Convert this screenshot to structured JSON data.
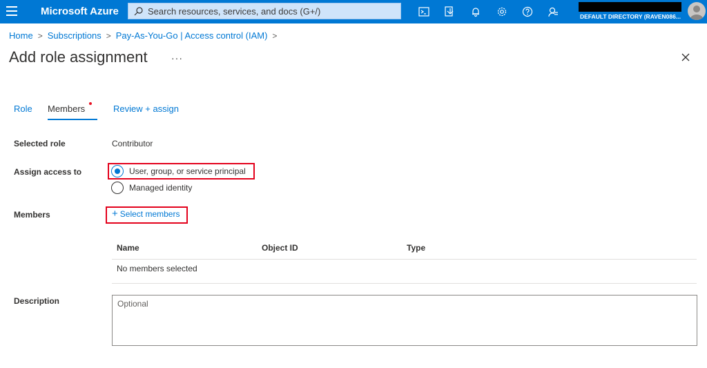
{
  "topbar": {
    "brand": "Microsoft Azure",
    "search_placeholder": "Search resources, services, and docs (G+/)",
    "icons": [
      "cloud-shell-icon",
      "directory-filter-icon",
      "notifications-icon",
      "settings-icon",
      "help-icon",
      "feedback-icon"
    ],
    "tenant": "DEFAULT DIRECTORY (RAVEN086..."
  },
  "breadcrumb": {
    "items": [
      "Home",
      "Subscriptions",
      "Pay-As-You-Go | Access control (IAM)"
    ]
  },
  "page": {
    "title": "Add role assignment",
    "more": "···"
  },
  "tabs": [
    {
      "label": "Role"
    },
    {
      "label": "Members"
    },
    {
      "label": "Review + assign"
    }
  ],
  "form": {
    "selected_role_label": "Selected role",
    "selected_role_value": "Contributor",
    "assign_access_label": "Assign access to",
    "options": [
      {
        "label": "User, group, or service principal",
        "checked": true
      },
      {
        "label": "Managed identity",
        "checked": false
      }
    ],
    "members_label": "Members",
    "select_members": "Select members",
    "table": {
      "columns": [
        "Name",
        "Object ID",
        "Type"
      ],
      "empty": "No members selected"
    },
    "description_label": "Description",
    "description_placeholder": "Optional"
  },
  "colors": {
    "accent": "#0078d4",
    "highlight": "#e3001b"
  }
}
